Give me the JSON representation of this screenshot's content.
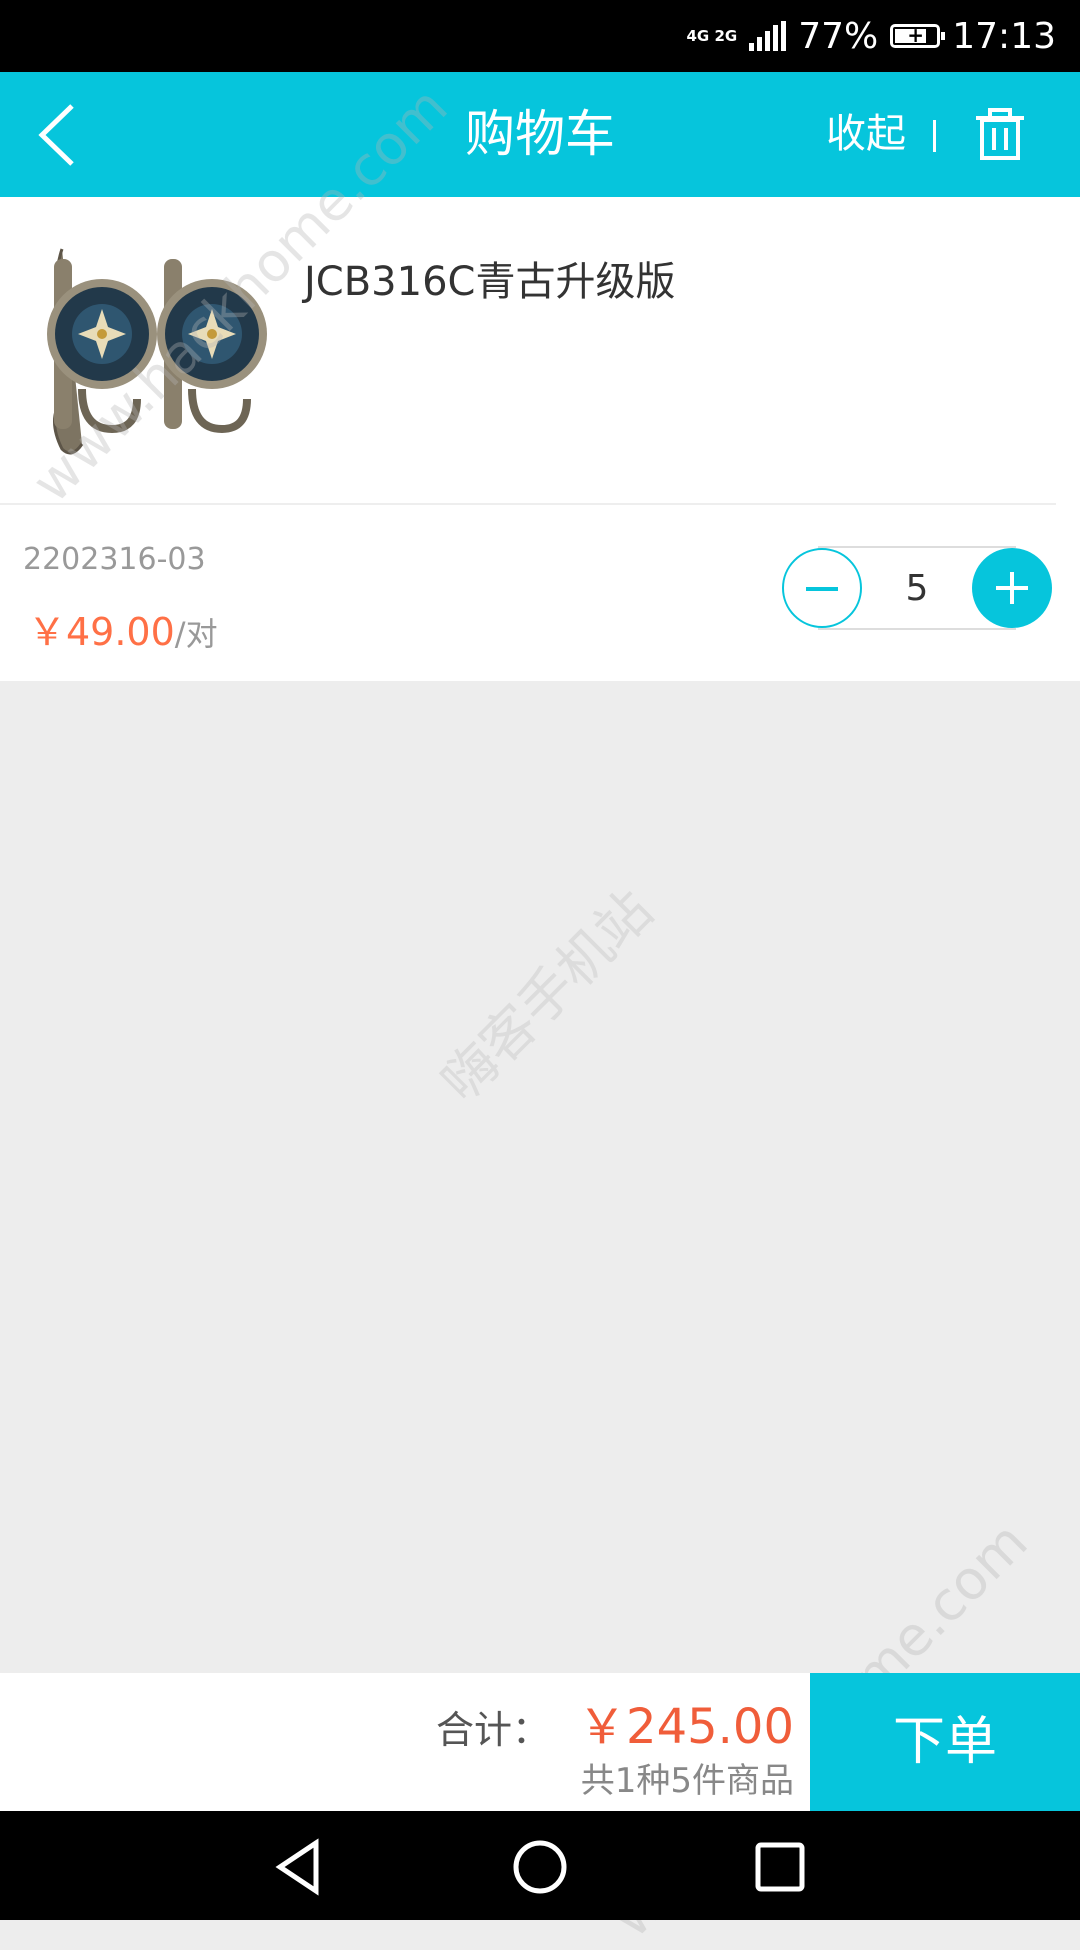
{
  "status_bar": {
    "network": "4G 2G",
    "battery": "77%",
    "time": "17:13"
  },
  "header": {
    "title": "购物车",
    "collapse_label": "收起",
    "back_icon": "back-arrow-icon",
    "delete_icon": "trash-icon"
  },
  "cart": {
    "items": [
      {
        "name": "JCB316C青古升级版",
        "code": "2202316-03",
        "price": "￥49.00",
        "unit": "/对",
        "quantity": "5"
      }
    ]
  },
  "footer": {
    "total_label": "合计：",
    "total_amount": "￥245.00",
    "summary": "共1种5件商品",
    "order_label": "下单"
  },
  "watermark": {
    "url": "www.hackhome.com",
    "site": "嗨客手机站"
  },
  "colors": {
    "accent": "#06c5dc",
    "price": "#ff7046",
    "background": "#ededed"
  }
}
